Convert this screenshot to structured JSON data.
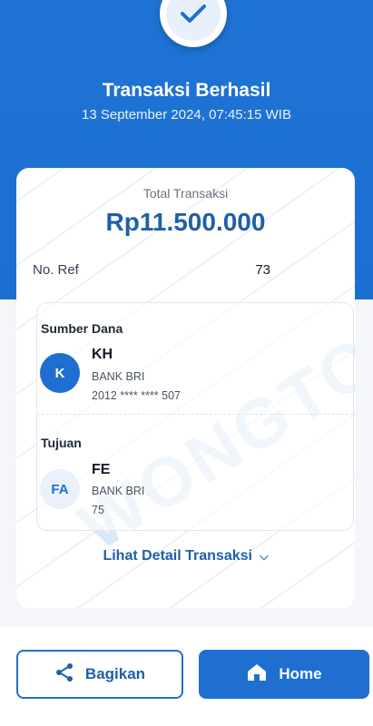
{
  "header": {
    "title": "Transaksi Berhasil",
    "datetime": "13 September 2024, 07:45:15 WIB"
  },
  "summary": {
    "total_label": "Total Transaksi",
    "total_amount": "Rp11.500.000",
    "ref_label": "No. Ref",
    "ref_value": "73"
  },
  "sumber_dana": {
    "title": "Sumber Dana",
    "avatar_initial": "K",
    "name": "KH",
    "bank": "BANK BRI",
    "account": "2012 **** **** 507"
  },
  "tujuan": {
    "title": "Tujuan",
    "avatar_initial": "FA",
    "name": "FE",
    "bank": "BANK BRI",
    "account": "75"
  },
  "links": {
    "detail": "Lihat Detail Transaksi"
  },
  "buttons": {
    "share_label": "Bagikan",
    "home_label": "Home"
  },
  "colors": {
    "primary": "#1f6fd0",
    "primary_dark": "#1f5fa8"
  }
}
